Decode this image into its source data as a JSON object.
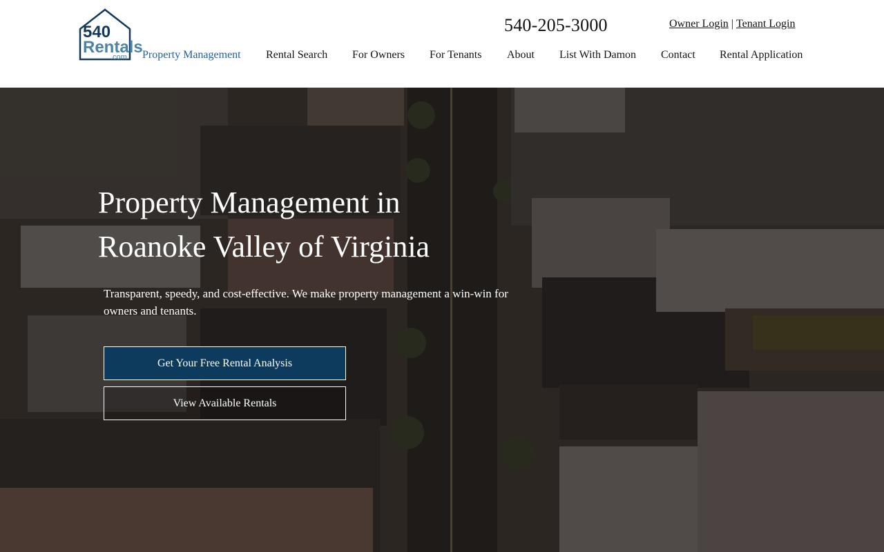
{
  "header": {
    "logo": {
      "line1": "540",
      "line2": "Rentals",
      "line3": ".com",
      "color": "#12395b"
    },
    "phone": "540-205-3000",
    "owner_login": "Owner Login",
    "separator": "|",
    "tenant_login": "Tenant Login",
    "nav": [
      {
        "label": "Property Management",
        "active": true
      },
      {
        "label": "Rental Search"
      },
      {
        "label": "For Owners"
      },
      {
        "label": "For Tenants"
      },
      {
        "label": "About"
      },
      {
        "label": "List With Damon"
      },
      {
        "label": "Contact"
      },
      {
        "label": "Rental Application"
      }
    ]
  },
  "hero": {
    "title_line1": "Property Management in",
    "title_line2": "Roanoke Valley of Virginia",
    "subtitle": "Transparent, speedy, and cost-effective. We make property management a win-win for owners and tenants.",
    "primary_button": "Get Your Free Rental Analysis",
    "secondary_button": "View Available Rentals",
    "primary_color": "#0d3b5e"
  },
  "colors": {
    "nav_active": "#1f5ea8",
    "text": "#111111"
  }
}
